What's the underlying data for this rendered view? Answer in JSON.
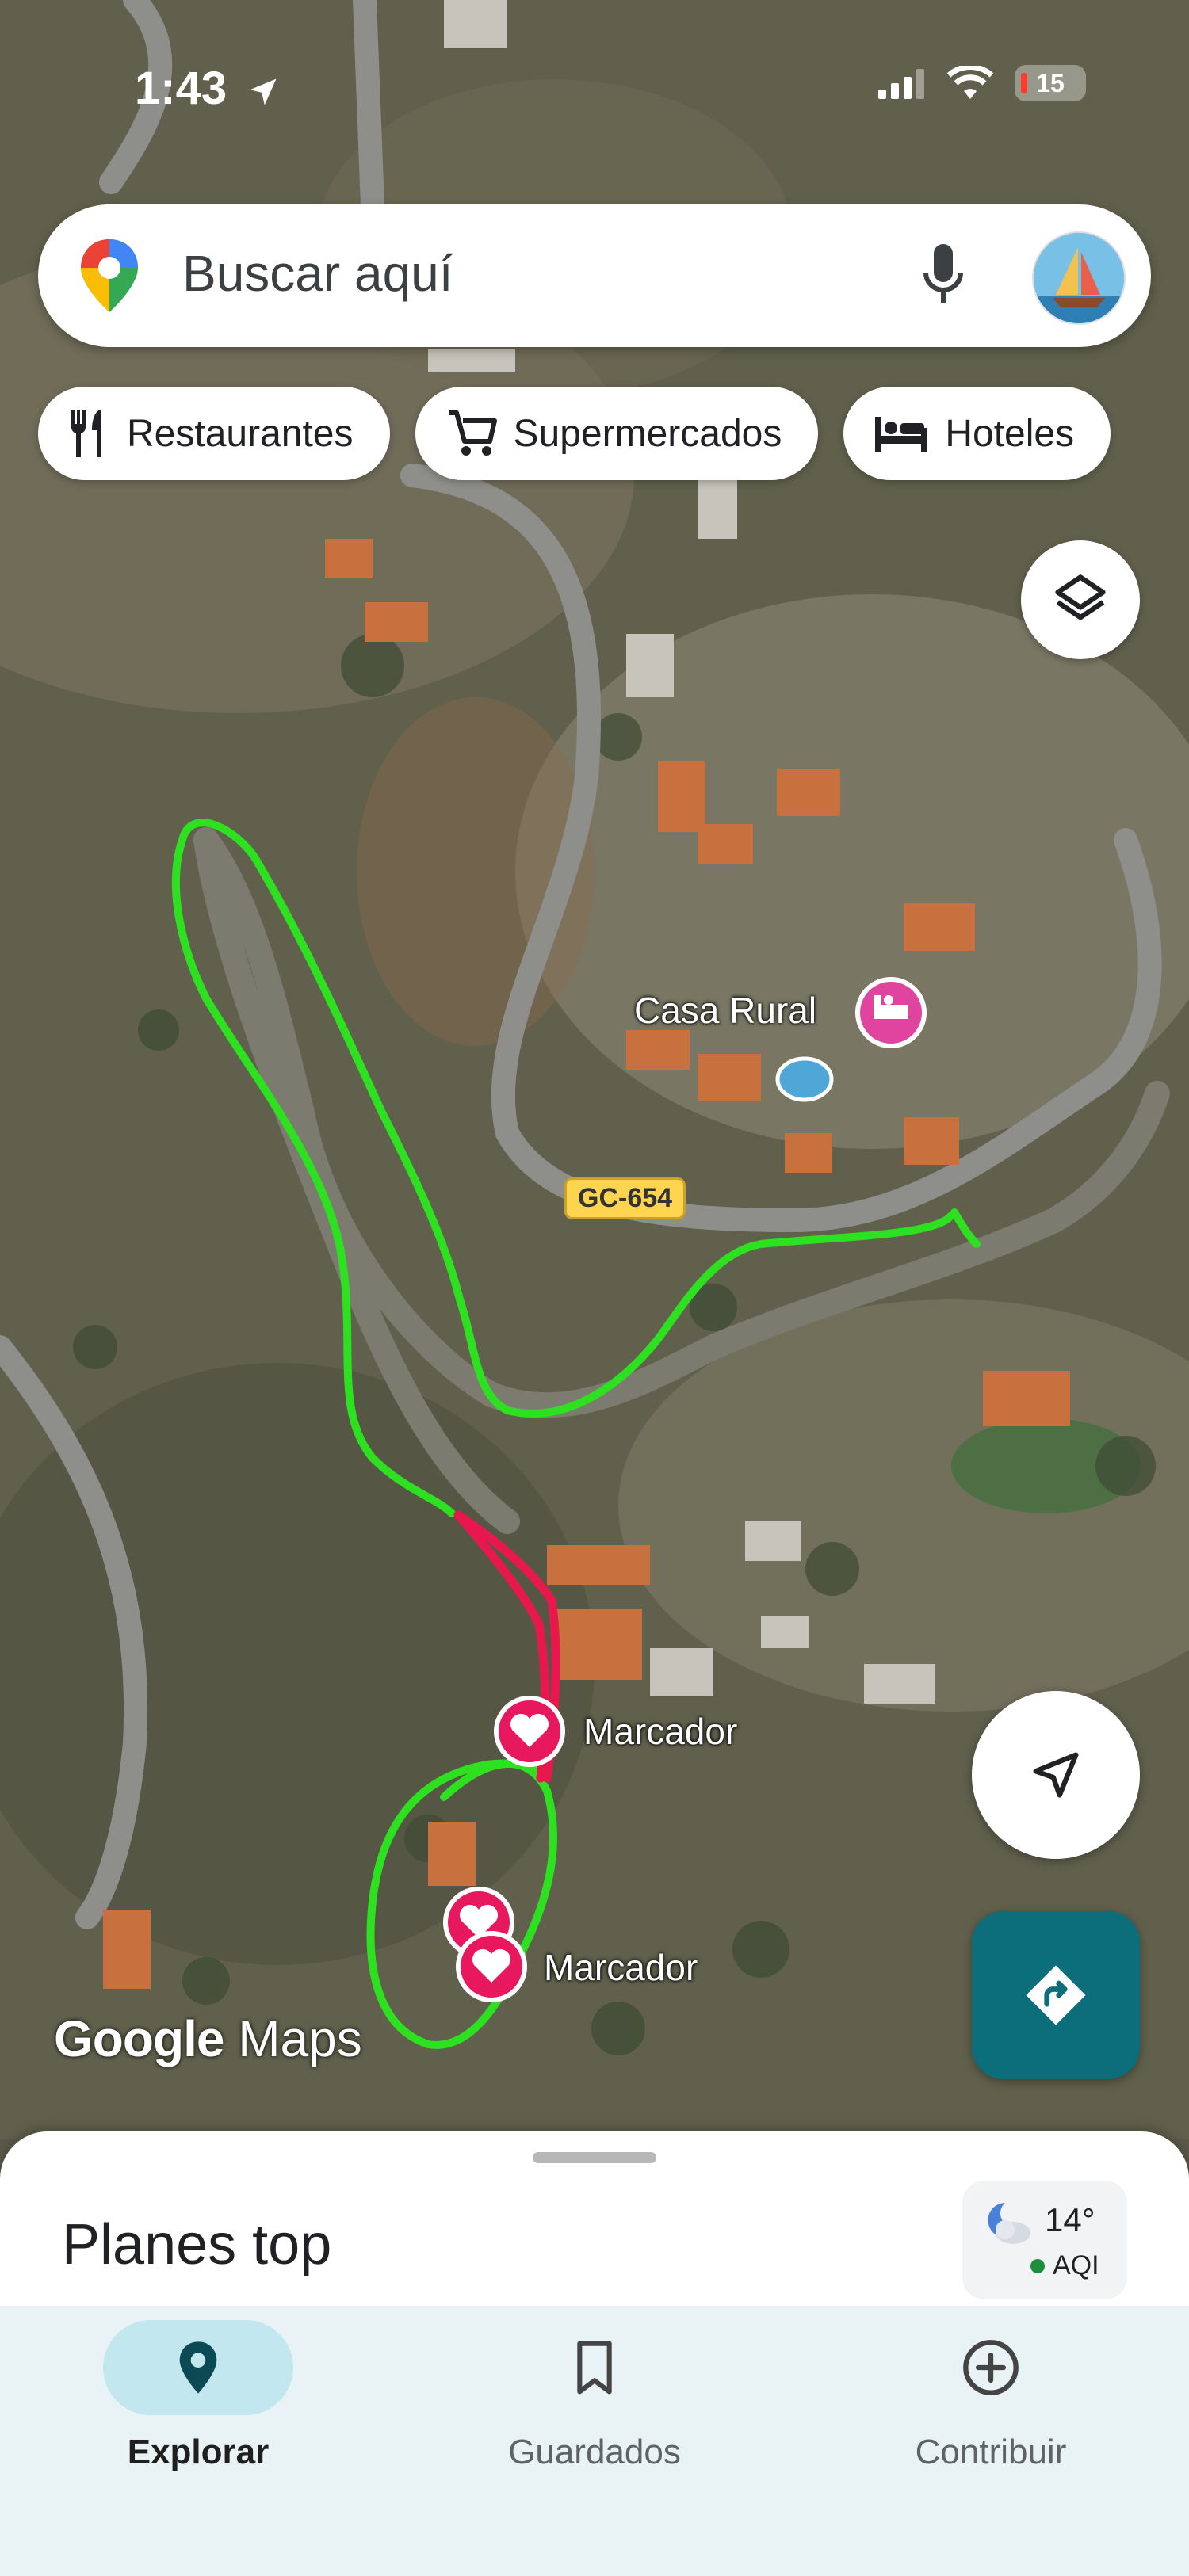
{
  "status_bar": {
    "time": "1:43",
    "battery": "15"
  },
  "search": {
    "placeholder": "Buscar aquí"
  },
  "chips": [
    {
      "label": "Restaurantes",
      "icon": "fork-knife-icon"
    },
    {
      "label": "Supermercados",
      "icon": "cart-icon"
    },
    {
      "label": "Hoteles",
      "icon": "bed-icon"
    }
  ],
  "map": {
    "places": [
      {
        "label": "Casa Rural",
        "icon": "hotel-pin-icon"
      },
      {
        "label": "Marcador",
        "icon": "heart-pin-icon"
      },
      {
        "label": "Marcador",
        "icon": "heart-pin-icon"
      }
    ],
    "road_label": "GC-654",
    "watermark_brand": "Google",
    "watermark_product": "Maps",
    "drawn_route_colors": {
      "green": "#2de020",
      "pink": "#e8184f"
    }
  },
  "sheet": {
    "title": "Planes top",
    "weather": {
      "temperature": "14°",
      "aqi_label": "AQI"
    }
  },
  "bottom_nav": [
    {
      "label": "Explorar",
      "icon": "pin-icon",
      "active": true
    },
    {
      "label": "Guardados",
      "icon": "bookmark-icon",
      "active": false
    },
    {
      "label": "Contribuir",
      "icon": "add-circle-icon",
      "active": false
    }
  ]
}
